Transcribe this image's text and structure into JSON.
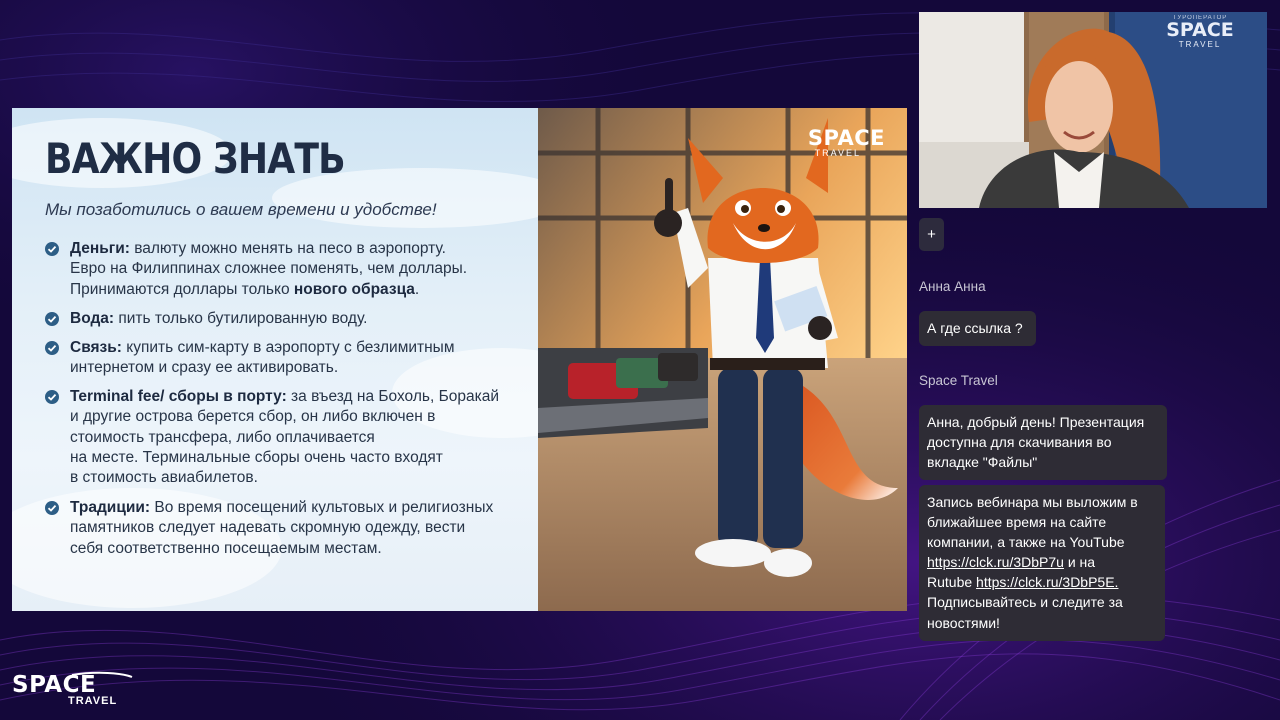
{
  "slide": {
    "title": "ВАЖНО ЗНАТЬ",
    "subtitle": "Мы позаботились о вашем времени и удобстве!",
    "bullets": [
      {
        "bold": "Деньги:",
        "lines": [
          " валюту можно менять на песо в аэропорту.",
          "Евро на Филиппинах сложнее поменять, чем доллары.",
          "Принимаются доллары только "
        ],
        "tail_bold": "нового образца",
        "tail": "."
      },
      {
        "bold": "Вода:",
        "lines": [
          " пить только бутилированную воду."
        ]
      },
      {
        "bold": "Связь:",
        "lines": [
          " купить сим-карту в аэропорту с безлимитным",
          "интернетом и сразу ее активировать."
        ]
      },
      {
        "bold": "Terminal fee/ сборы в порту:",
        "lines": [
          " за въезд на Бохоль, Боракай",
          "и другие острова берется сбор, он либо включен в",
          "стоимость трансфера, либо оплачивается",
          "на месте. Терминальные сборы очень часто входят",
          "в стоимость авиабилетов."
        ]
      },
      {
        "bold": "Традиции:",
        "lines": [
          " Во время посещений культовых и религиозных",
          "памятников следует надевать скромную одежду, вести",
          "себя соответственно посещаемым местам."
        ]
      }
    ],
    "logo_text": "SPACE",
    "logo_sub": "TRAVEL",
    "illustration": "fox-pilot-airport-illustration"
  },
  "webcam": {
    "banner_title": "SPACE",
    "banner_sub": "TRAVEL",
    "banner_top": "ТУРОПЕРАТОР"
  },
  "chat": {
    "add_label": "+",
    "messages": [
      {
        "sender": "Анна Анна",
        "lines": [
          "А где ссылка ?"
        ]
      },
      {
        "sender": "Space Travel",
        "lines": [
          "Анна, добрый день! Презентация",
          "доступна для скачивания во",
          "вкладке \"Файлы\""
        ]
      }
    ],
    "message3": {
      "lines": [
        "Запись вебинара мы выложим в",
        "ближайшее время на сайте",
        "компании, а также на YouTube"
      ],
      "link1": "https://clck.ru/3DbP7u",
      "between": " и на",
      "prefix2": "Rutube ",
      "link2": "https://clck.ru/3DbP5E.",
      "end_lines": [
        "Подписывайтесь и следите за",
        "новостями!"
      ]
    }
  },
  "footer_logo": {
    "text": "SPACE",
    "sub": "TRAVEL"
  },
  "colors": {
    "background": "#14083a",
    "accent_purple": "#7a2bd6",
    "chat_bubble": "#2e2c35",
    "slide_title": "#1f2d45",
    "check": "#2d5e86"
  }
}
